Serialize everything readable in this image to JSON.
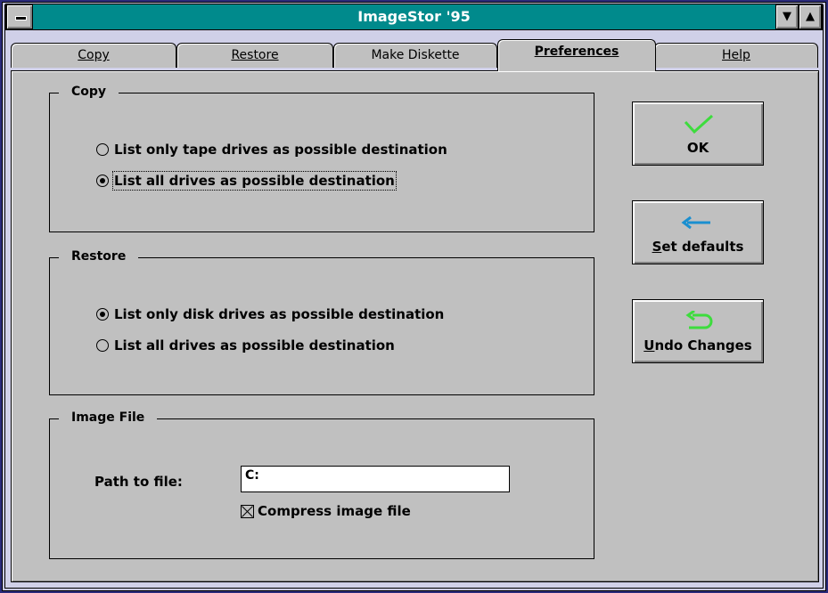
{
  "window": {
    "title": "ImageStor '95"
  },
  "tabs": [
    {
      "label": "Copy"
    },
    {
      "label": "Restore"
    },
    {
      "label": "Make Diskette"
    },
    {
      "label": "Preferences"
    },
    {
      "label": "Help"
    }
  ],
  "copy_group": {
    "title": "Copy",
    "options": [
      {
        "label": "List only tape drives as possible destination",
        "selected": false
      },
      {
        "label": "List all drives as possible destination",
        "selected": true
      }
    ]
  },
  "restore_group": {
    "title": "Restore",
    "options": [
      {
        "label": "List only disk drives as possible destination",
        "selected": true
      },
      {
        "label": "List all drives as possible destination",
        "selected": false
      }
    ]
  },
  "image_file_group": {
    "title": "Image File",
    "path_label": "Path to file:",
    "path_value": "C:",
    "compress_label": "Compress image file",
    "compress_checked": true
  },
  "buttons": {
    "ok": "OK",
    "set_defaults": "Set defaults",
    "undo_changes": "Undo Changes"
  },
  "colors": {
    "titlebar": "#008a8c",
    "ok_icon": "#3ddc3d",
    "set_defaults_icon": "#1a8fd0",
    "undo_icon": "#3ddc3d"
  }
}
